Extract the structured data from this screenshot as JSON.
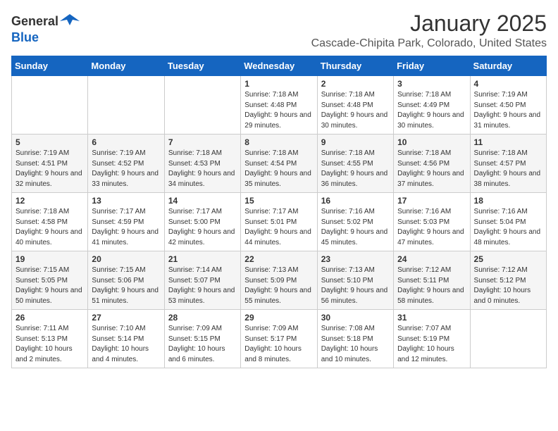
{
  "header": {
    "logo_general": "General",
    "logo_blue": "Blue",
    "month_title": "January 2025",
    "location": "Cascade-Chipita Park, Colorado, United States"
  },
  "weekdays": [
    "Sunday",
    "Monday",
    "Tuesday",
    "Wednesday",
    "Thursday",
    "Friday",
    "Saturday"
  ],
  "weeks": [
    [
      {
        "day": null,
        "info": null
      },
      {
        "day": null,
        "info": null
      },
      {
        "day": null,
        "info": null
      },
      {
        "day": "1",
        "info": "Sunrise: 7:18 AM\nSunset: 4:48 PM\nDaylight: 9 hours and 29 minutes."
      },
      {
        "day": "2",
        "info": "Sunrise: 7:18 AM\nSunset: 4:48 PM\nDaylight: 9 hours and 30 minutes."
      },
      {
        "day": "3",
        "info": "Sunrise: 7:18 AM\nSunset: 4:49 PM\nDaylight: 9 hours and 30 minutes."
      },
      {
        "day": "4",
        "info": "Sunrise: 7:19 AM\nSunset: 4:50 PM\nDaylight: 9 hours and 31 minutes."
      }
    ],
    [
      {
        "day": "5",
        "info": "Sunrise: 7:19 AM\nSunset: 4:51 PM\nDaylight: 9 hours and 32 minutes."
      },
      {
        "day": "6",
        "info": "Sunrise: 7:19 AM\nSunset: 4:52 PM\nDaylight: 9 hours and 33 minutes."
      },
      {
        "day": "7",
        "info": "Sunrise: 7:18 AM\nSunset: 4:53 PM\nDaylight: 9 hours and 34 minutes."
      },
      {
        "day": "8",
        "info": "Sunrise: 7:18 AM\nSunset: 4:54 PM\nDaylight: 9 hours and 35 minutes."
      },
      {
        "day": "9",
        "info": "Sunrise: 7:18 AM\nSunset: 4:55 PM\nDaylight: 9 hours and 36 minutes."
      },
      {
        "day": "10",
        "info": "Sunrise: 7:18 AM\nSunset: 4:56 PM\nDaylight: 9 hours and 37 minutes."
      },
      {
        "day": "11",
        "info": "Sunrise: 7:18 AM\nSunset: 4:57 PM\nDaylight: 9 hours and 38 minutes."
      }
    ],
    [
      {
        "day": "12",
        "info": "Sunrise: 7:18 AM\nSunset: 4:58 PM\nDaylight: 9 hours and 40 minutes."
      },
      {
        "day": "13",
        "info": "Sunrise: 7:17 AM\nSunset: 4:59 PM\nDaylight: 9 hours and 41 minutes."
      },
      {
        "day": "14",
        "info": "Sunrise: 7:17 AM\nSunset: 5:00 PM\nDaylight: 9 hours and 42 minutes."
      },
      {
        "day": "15",
        "info": "Sunrise: 7:17 AM\nSunset: 5:01 PM\nDaylight: 9 hours and 44 minutes."
      },
      {
        "day": "16",
        "info": "Sunrise: 7:16 AM\nSunset: 5:02 PM\nDaylight: 9 hours and 45 minutes."
      },
      {
        "day": "17",
        "info": "Sunrise: 7:16 AM\nSunset: 5:03 PM\nDaylight: 9 hours and 47 minutes."
      },
      {
        "day": "18",
        "info": "Sunrise: 7:16 AM\nSunset: 5:04 PM\nDaylight: 9 hours and 48 minutes."
      }
    ],
    [
      {
        "day": "19",
        "info": "Sunrise: 7:15 AM\nSunset: 5:05 PM\nDaylight: 9 hours and 50 minutes."
      },
      {
        "day": "20",
        "info": "Sunrise: 7:15 AM\nSunset: 5:06 PM\nDaylight: 9 hours and 51 minutes."
      },
      {
        "day": "21",
        "info": "Sunrise: 7:14 AM\nSunset: 5:07 PM\nDaylight: 9 hours and 53 minutes."
      },
      {
        "day": "22",
        "info": "Sunrise: 7:13 AM\nSunset: 5:09 PM\nDaylight: 9 hours and 55 minutes."
      },
      {
        "day": "23",
        "info": "Sunrise: 7:13 AM\nSunset: 5:10 PM\nDaylight: 9 hours and 56 minutes."
      },
      {
        "day": "24",
        "info": "Sunrise: 7:12 AM\nSunset: 5:11 PM\nDaylight: 9 hours and 58 minutes."
      },
      {
        "day": "25",
        "info": "Sunrise: 7:12 AM\nSunset: 5:12 PM\nDaylight: 10 hours and 0 minutes."
      }
    ],
    [
      {
        "day": "26",
        "info": "Sunrise: 7:11 AM\nSunset: 5:13 PM\nDaylight: 10 hours and 2 minutes."
      },
      {
        "day": "27",
        "info": "Sunrise: 7:10 AM\nSunset: 5:14 PM\nDaylight: 10 hours and 4 minutes."
      },
      {
        "day": "28",
        "info": "Sunrise: 7:09 AM\nSunset: 5:15 PM\nDaylight: 10 hours and 6 minutes."
      },
      {
        "day": "29",
        "info": "Sunrise: 7:09 AM\nSunset: 5:17 PM\nDaylight: 10 hours and 8 minutes."
      },
      {
        "day": "30",
        "info": "Sunrise: 7:08 AM\nSunset: 5:18 PM\nDaylight: 10 hours and 10 minutes."
      },
      {
        "day": "31",
        "info": "Sunrise: 7:07 AM\nSunset: 5:19 PM\nDaylight: 10 hours and 12 minutes."
      },
      {
        "day": null,
        "info": null
      }
    ]
  ]
}
